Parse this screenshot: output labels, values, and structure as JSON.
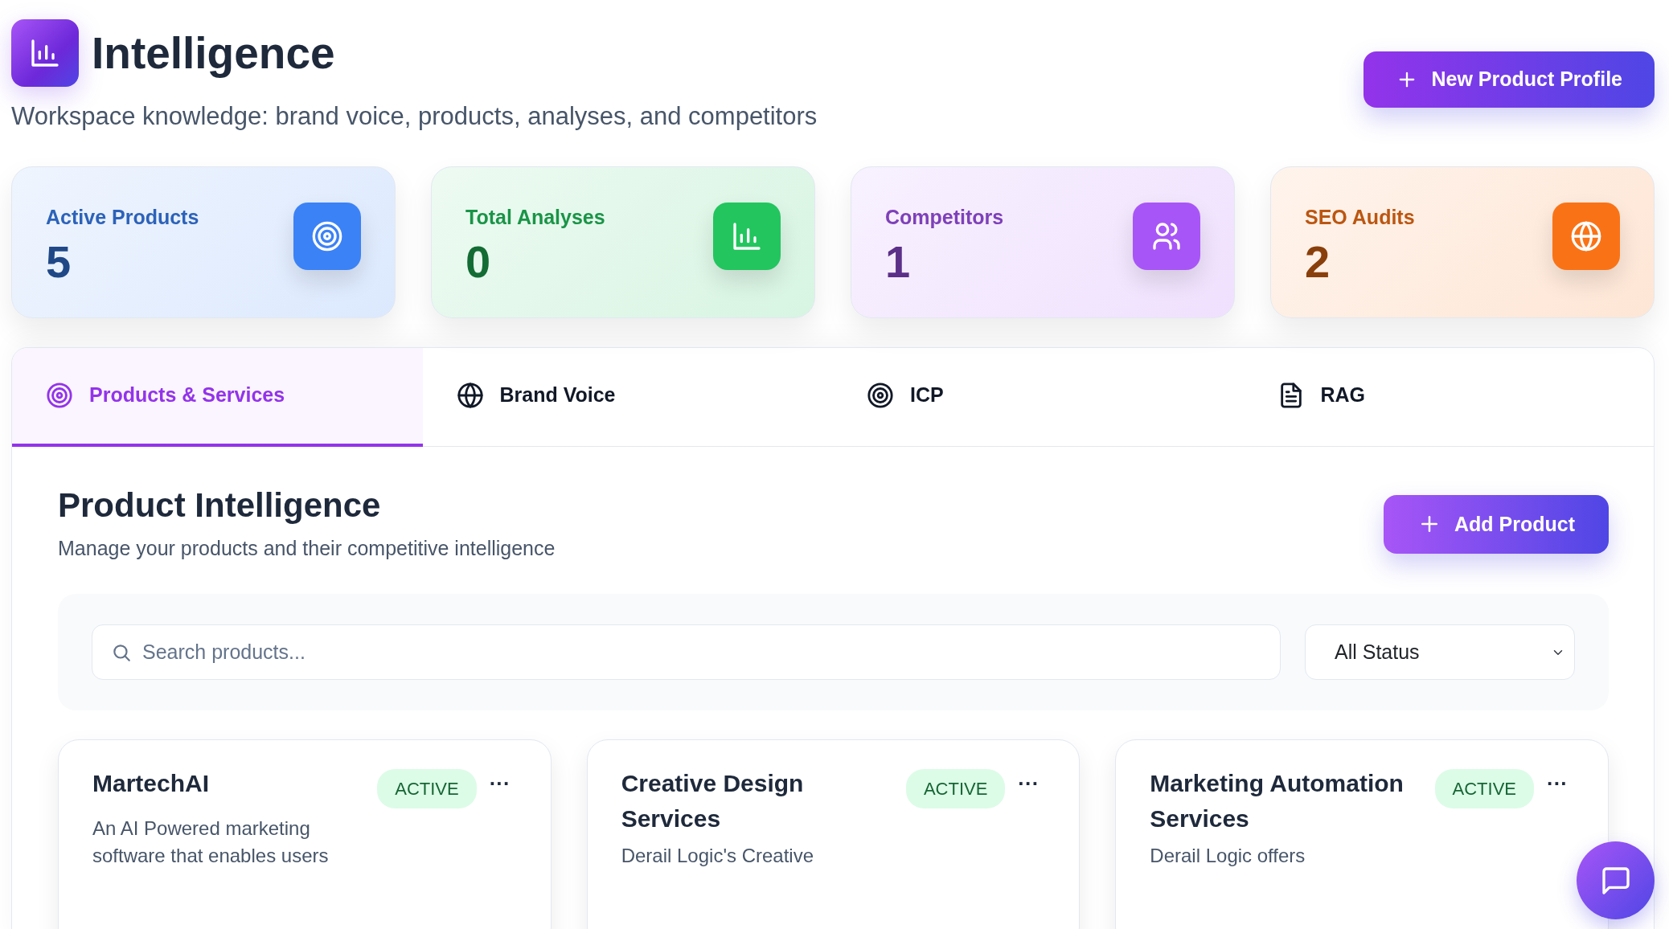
{
  "header": {
    "title": "Intelligence",
    "subtitle": "Workspace knowledge: brand voice, products, analyses, and competitors",
    "action": "New Product Profile"
  },
  "stats": [
    {
      "label": "Active Products",
      "value": "5",
      "kind": "target",
      "color": "#3b82f6"
    },
    {
      "label": "Total Analyses",
      "value": "0",
      "kind": "chart",
      "color": "#22c55e"
    },
    {
      "label": "Competitors",
      "value": "1",
      "kind": "users",
      "color": "#a855f7"
    },
    {
      "label": "SEO Audits",
      "value": "2",
      "kind": "globe",
      "color": "#f97316"
    }
  ],
  "tabs": [
    {
      "label": "Products & Services",
      "kind": "target",
      "selected": true
    },
    {
      "label": "Brand Voice",
      "kind": "globe",
      "selected": false
    },
    {
      "label": "ICP",
      "kind": "target",
      "selected": false
    },
    {
      "label": "RAG",
      "kind": "document",
      "selected": false
    }
  ],
  "section": {
    "title": "Product Intelligence",
    "subtitle": "Manage your products and their competitive intelligence",
    "action": "Add Product"
  },
  "search": {
    "placeholder": "Search products..."
  },
  "status_filter": {
    "value": "All Status"
  },
  "products": [
    {
      "name": "MartechAI",
      "status": "ACTIVE",
      "menu": "···",
      "description": "An AI Powered marketing software that enables users"
    },
    {
      "name": "Creative Design Services",
      "status": "ACTIVE",
      "menu": "···",
      "description": "Derail Logic's Creative"
    },
    {
      "name": "Marketing Automation Services",
      "status": "ACTIVE",
      "menu": "···",
      "description": "Derail Logic offers"
    }
  ]
}
